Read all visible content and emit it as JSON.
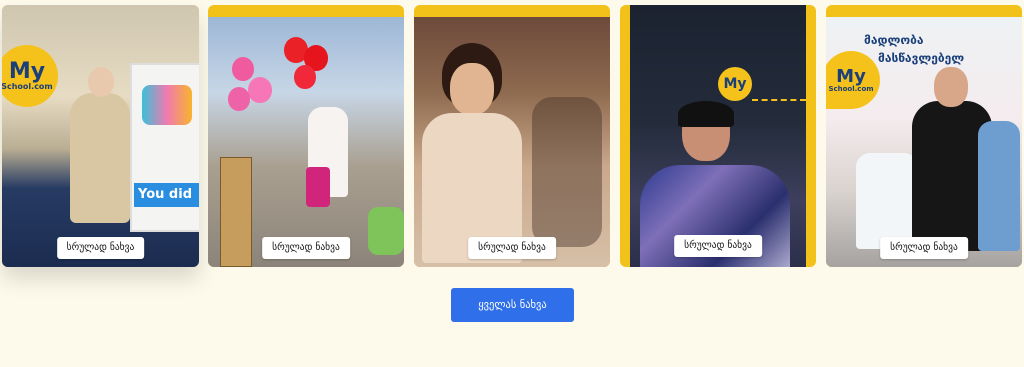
{
  "gallery": {
    "cards": [
      {
        "button_label": "სრულად ნახვა",
        "logo_main": "My",
        "logo_sub": "School.com",
        "board_text": "You did"
      },
      {
        "button_label": "სრულად ნახვა"
      },
      {
        "button_label": "სრულად ნახვა"
      },
      {
        "button_label": "სრულად ნახვა"
      },
      {
        "button_label": "სრულად ნახვა",
        "banner_line1": "მადლობა",
        "banner_line2": "მასწავლებელ"
      }
    ]
  },
  "view_all_label": "ყველას ნახვა",
  "colors": {
    "accent": "#2f6fea",
    "card_frame": "#f2c21a",
    "background": "#fdfaeb"
  }
}
